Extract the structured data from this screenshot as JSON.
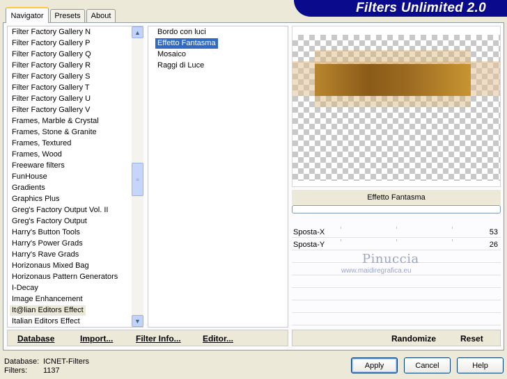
{
  "app": {
    "title": "Filters Unlimited 2.0"
  },
  "tabs": [
    {
      "label": "Navigator",
      "active": true
    },
    {
      "label": "Presets",
      "active": false
    },
    {
      "label": "About",
      "active": false
    }
  ],
  "categories": {
    "items": [
      "Filter Factory Gallery N",
      "Filter Factory Gallery P",
      "Filter Factory Gallery Q",
      "Filter Factory Gallery R",
      "Filter Factory Gallery S",
      "Filter Factory Gallery T",
      "Filter Factory Gallery U",
      "Filter Factory Gallery V",
      "Frames, Marble & Crystal",
      "Frames, Stone & Granite",
      "Frames, Textured",
      "Frames, Wood",
      "Freeware filters",
      "FunHouse",
      "Gradients",
      "Graphics Plus",
      "Greg's Factory Output Vol. II",
      "Greg's Factory Output",
      "Harry's Button Tools",
      "Harry's Power Grads",
      "Harry's Rave Grads",
      "Horizonaus Mixed Bag",
      "Horizonaus Pattern Generators",
      "I-Decay",
      "Image Enhancement",
      "It@lian Editors Effect",
      "Italian Editors Effect"
    ],
    "selected": "It@lian Editors Effect"
  },
  "filters": {
    "items": [
      "Bordo con luci",
      "Effetto Fantasma",
      "Mosaico",
      "Raggi di Luce"
    ],
    "selected": "Effetto Fantasma"
  },
  "preview": {
    "filter_name": "Effetto Fantasma"
  },
  "params": [
    {
      "label": "Sposta-X",
      "value": "53"
    },
    {
      "label": "Sposta-Y",
      "value": "26"
    }
  ],
  "watermark": {
    "name": "Pinuccia",
    "url": "www.maidiregrafica.eu"
  },
  "toolbar": {
    "database": "Database",
    "import": "Import...",
    "filter_info": "Filter Info...",
    "editor": "Editor...",
    "randomize": "Randomize",
    "reset": "Reset"
  },
  "footer": {
    "database_label": "Database:",
    "database_value": "ICNET-Filters",
    "filters_label": "Filters:",
    "filters_value": "1137",
    "apply": "Apply",
    "cancel": "Cancel",
    "help": "Help"
  },
  "colors": {
    "banner": "#0a0a8c",
    "selection": "#316ac5",
    "window_bg": "#ece9d8"
  }
}
